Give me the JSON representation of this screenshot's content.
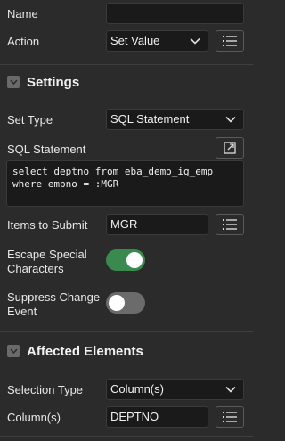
{
  "fields": {
    "name": {
      "label": "Name",
      "value": ""
    },
    "action": {
      "label": "Action",
      "value": "Set Value"
    }
  },
  "settings": {
    "title": "Settings",
    "set_type": {
      "label": "Set Type",
      "value": "SQL Statement"
    },
    "sql_statement": {
      "label": "SQL Statement",
      "value": "select deptno from eba_demo_ig_emp where empno = :MGR"
    },
    "items_to_submit": {
      "label": "Items to Submit",
      "value": "MGR"
    },
    "escape_special_characters": {
      "label_line1": "Escape Special",
      "label_line2": "Characters",
      "on": true
    },
    "suppress_change_event": {
      "label_line1": "Suppress Change",
      "label_line2": "Event",
      "on": false
    }
  },
  "affected_elements": {
    "title": "Affected Elements",
    "selection_type": {
      "label": "Selection Type",
      "value": "Column(s)"
    },
    "columns": {
      "label": "Column(s)",
      "value": "DEPTNO"
    }
  },
  "colors": {
    "toggle_on": "#3a8a50",
    "toggle_off": "#6b6b6b"
  }
}
